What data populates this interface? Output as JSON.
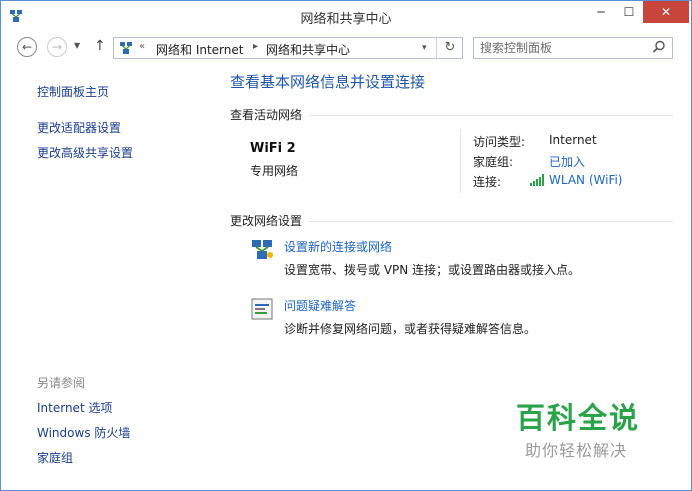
{
  "window": {
    "title": "网络和共享中心",
    "controls": {
      "minimize": "─",
      "maximize": "☐",
      "close": "✕"
    }
  },
  "nav": {
    "back": "←",
    "forward": "→",
    "recent": "▼",
    "up": "↑",
    "breadcrumb": [
      "网络和 Internet",
      "网络和共享中心"
    ],
    "overflow": "«",
    "separator": "▸",
    "dropdown": "▾",
    "refresh": "↻"
  },
  "search": {
    "placeholder": "搜索控制面板",
    "icon": "search-icon"
  },
  "sidebar": {
    "home": "控制面板主页",
    "adapter": "更改适配器设置",
    "sharing": "更改高级共享设置",
    "see_also_heading": "另请参阅",
    "see_also": [
      "Internet 选项",
      "Windows 防火墙",
      "家庭组"
    ]
  },
  "main": {
    "title": "查看基本网络信息并设置连接",
    "active_networks_heading": "查看活动网络",
    "network": {
      "name": "WiFi  2",
      "type": "专用网络",
      "access_type_label": "访问类型:",
      "access_type_value": "Internet",
      "homegroup_label": "家庭组:",
      "homegroup_value": "已加入",
      "connections_label": "连接:",
      "connections_value": "WLAN (WiFi)"
    },
    "change_heading": "更改网络设置",
    "tasks": [
      {
        "link": "设置新的连接或网络",
        "desc": "设置宽带、拨号或 VPN 连接；或设置路由器或接入点。",
        "icon": "new-connection-icon"
      },
      {
        "link": "问题疑难解答",
        "desc": "诊断并修复网络问题，或者获得疑难解答信息。",
        "icon": "troubleshoot-icon"
      }
    ]
  },
  "watermark": {
    "brand": "百科全说",
    "tagline": "助你轻松解决"
  },
  "colors": {
    "link": "#1e66c0",
    "title": "#1e57a8",
    "close": "#c7453b",
    "brand": "#2aa34a",
    "border": "#5a8fd6"
  }
}
